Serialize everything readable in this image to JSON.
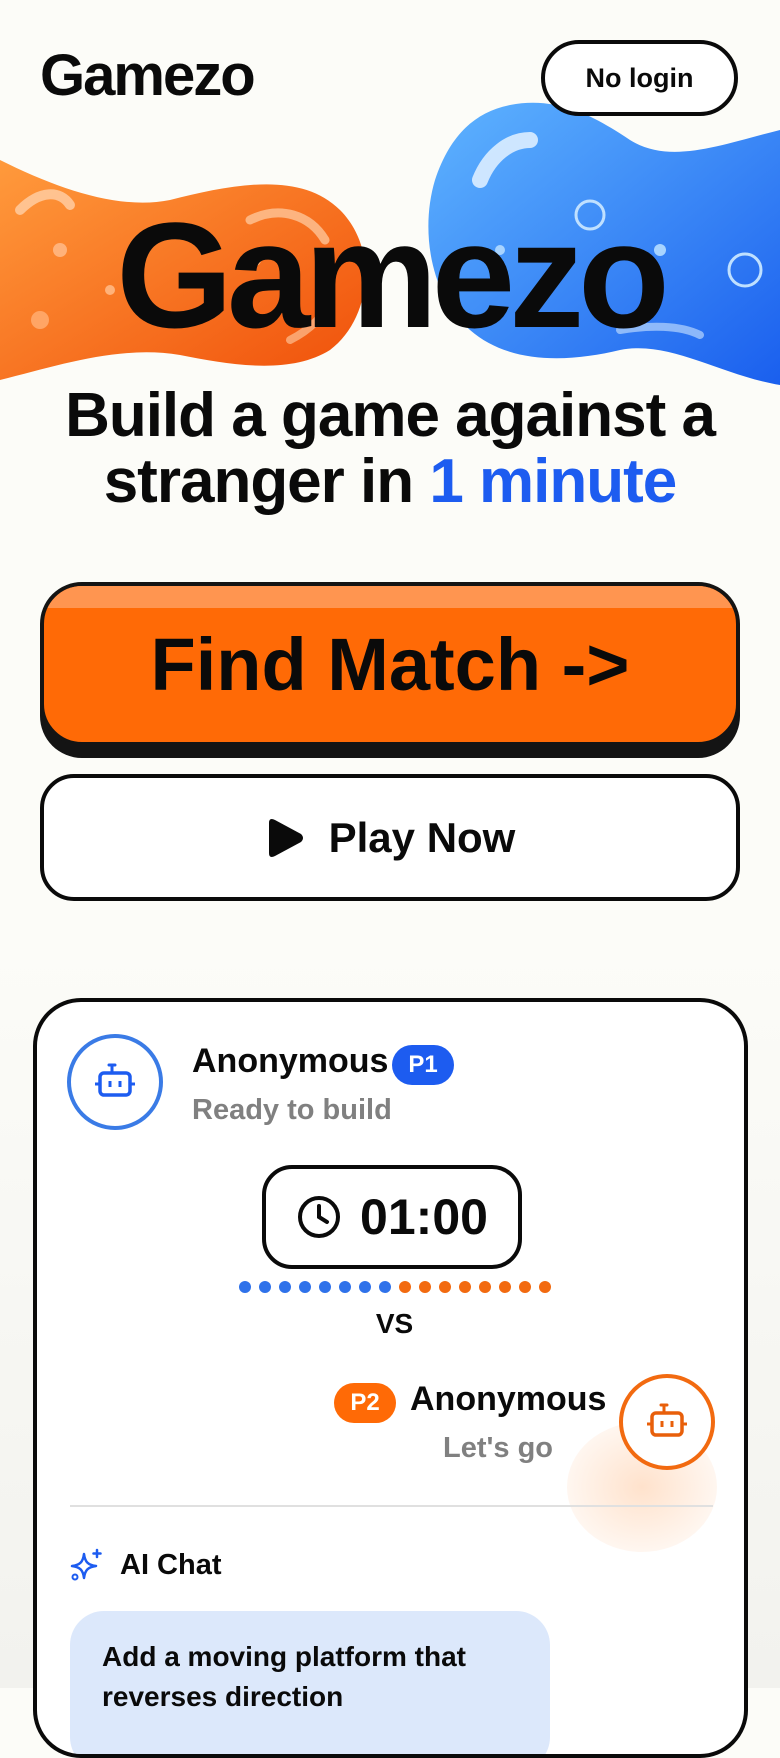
{
  "header": {
    "logo": "Gamezo",
    "no_login_label": "No login"
  },
  "hero": {
    "title": "Gamezo",
    "tagline_line1": "Build a game against a",
    "tagline_line2_prefix": "stranger in ",
    "tagline_highlight": "1 minute"
  },
  "actions": {
    "find_match_label": "Find Match  ->",
    "play_now_label": "Play Now"
  },
  "match_card": {
    "player1": {
      "name": "Anonymous",
      "badge": "P1",
      "status": "Ready to build"
    },
    "timer": "01:00",
    "vs_label": "VS",
    "player2": {
      "name": "Anonymous",
      "badge": "P2",
      "status": "Let's go"
    },
    "ai_chat_title": "AI Chat",
    "ai_message": "Add a moving platform that reverses direction"
  },
  "colors": {
    "accent_blue": "#1d5cf0",
    "accent_orange": "#ff6a06",
    "ink": "#0a0a0a",
    "background": "#fcfcf8"
  },
  "icons": [
    "robot-icon",
    "clock-icon",
    "play-icon",
    "sparkle-icon"
  ]
}
